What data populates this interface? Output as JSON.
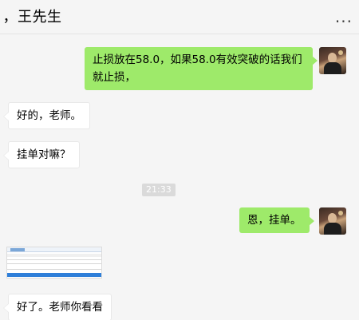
{
  "header": {
    "title": "王先生",
    "title_prefix": "：，",
    "more_label": "..."
  },
  "messages": [
    {
      "side": "sent",
      "text_line1": "止损放在58.0，如果58.0有效突破的话我们",
      "text_line2": "就止损，"
    },
    {
      "side": "recv",
      "text": "好的，老师。"
    },
    {
      "side": "recv",
      "text": "挂单对嘛？"
    },
    {
      "side": "sent",
      "text": "恩，挂单。"
    },
    {
      "side": "recv",
      "text": "好了。老师你看看"
    }
  ],
  "timestamp": "21:33",
  "image_message": {
    "icon": "screenshot-thumbnail"
  },
  "colors": {
    "sent_bubble": "#9eea6a",
    "recv_bubble": "#ffffff",
    "background": "#f5f5f5"
  }
}
